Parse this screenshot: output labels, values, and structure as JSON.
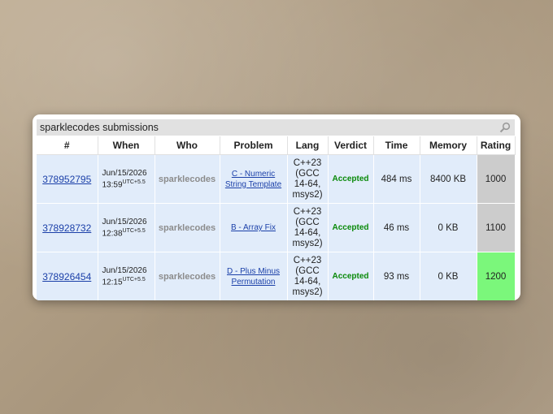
{
  "panel": {
    "title": "sparklecodes submissions",
    "search_icon": "search-icon"
  },
  "columns": [
    "#",
    "When",
    "Who",
    "Problem",
    "Lang",
    "Verdict",
    "Time",
    "Memory",
    "Rating"
  ],
  "rows": [
    {
      "id": "378952795",
      "date": "Jun/15/2026",
      "time": "13:59",
      "tz": "UTC+5.5",
      "who": "sparklecodes",
      "problem": "C - Numeric String Template",
      "lang": "C++23 (GCC 14-64, msys2)",
      "verdict": "Accepted",
      "exec_time": "484 ms",
      "memory": "8400 KB",
      "rating": "1000",
      "rating_color": "#cccccc"
    },
    {
      "id": "378928732",
      "date": "Jun/15/2026",
      "time": "12:38",
      "tz": "UTC+5.5",
      "who": "sparklecodes",
      "problem": "B - Array Fix",
      "lang": "C++23 (GCC 14-64, msys2)",
      "verdict": "Accepted",
      "exec_time": "46 ms",
      "memory": "0 KB",
      "rating": "1100",
      "rating_color": "#cccccc"
    },
    {
      "id": "378926454",
      "date": "Jun/15/2026",
      "time": "12:15",
      "tz": "UTC+5.5",
      "who": "sparklecodes",
      "problem": "D - Plus Minus Permutation",
      "lang": "C++23 (GCC 14-64, msys2)",
      "verdict": "Accepted",
      "exec_time": "93 ms",
      "memory": "0 KB",
      "rating": "1200",
      "rating_color": "#7bf77b"
    }
  ]
}
